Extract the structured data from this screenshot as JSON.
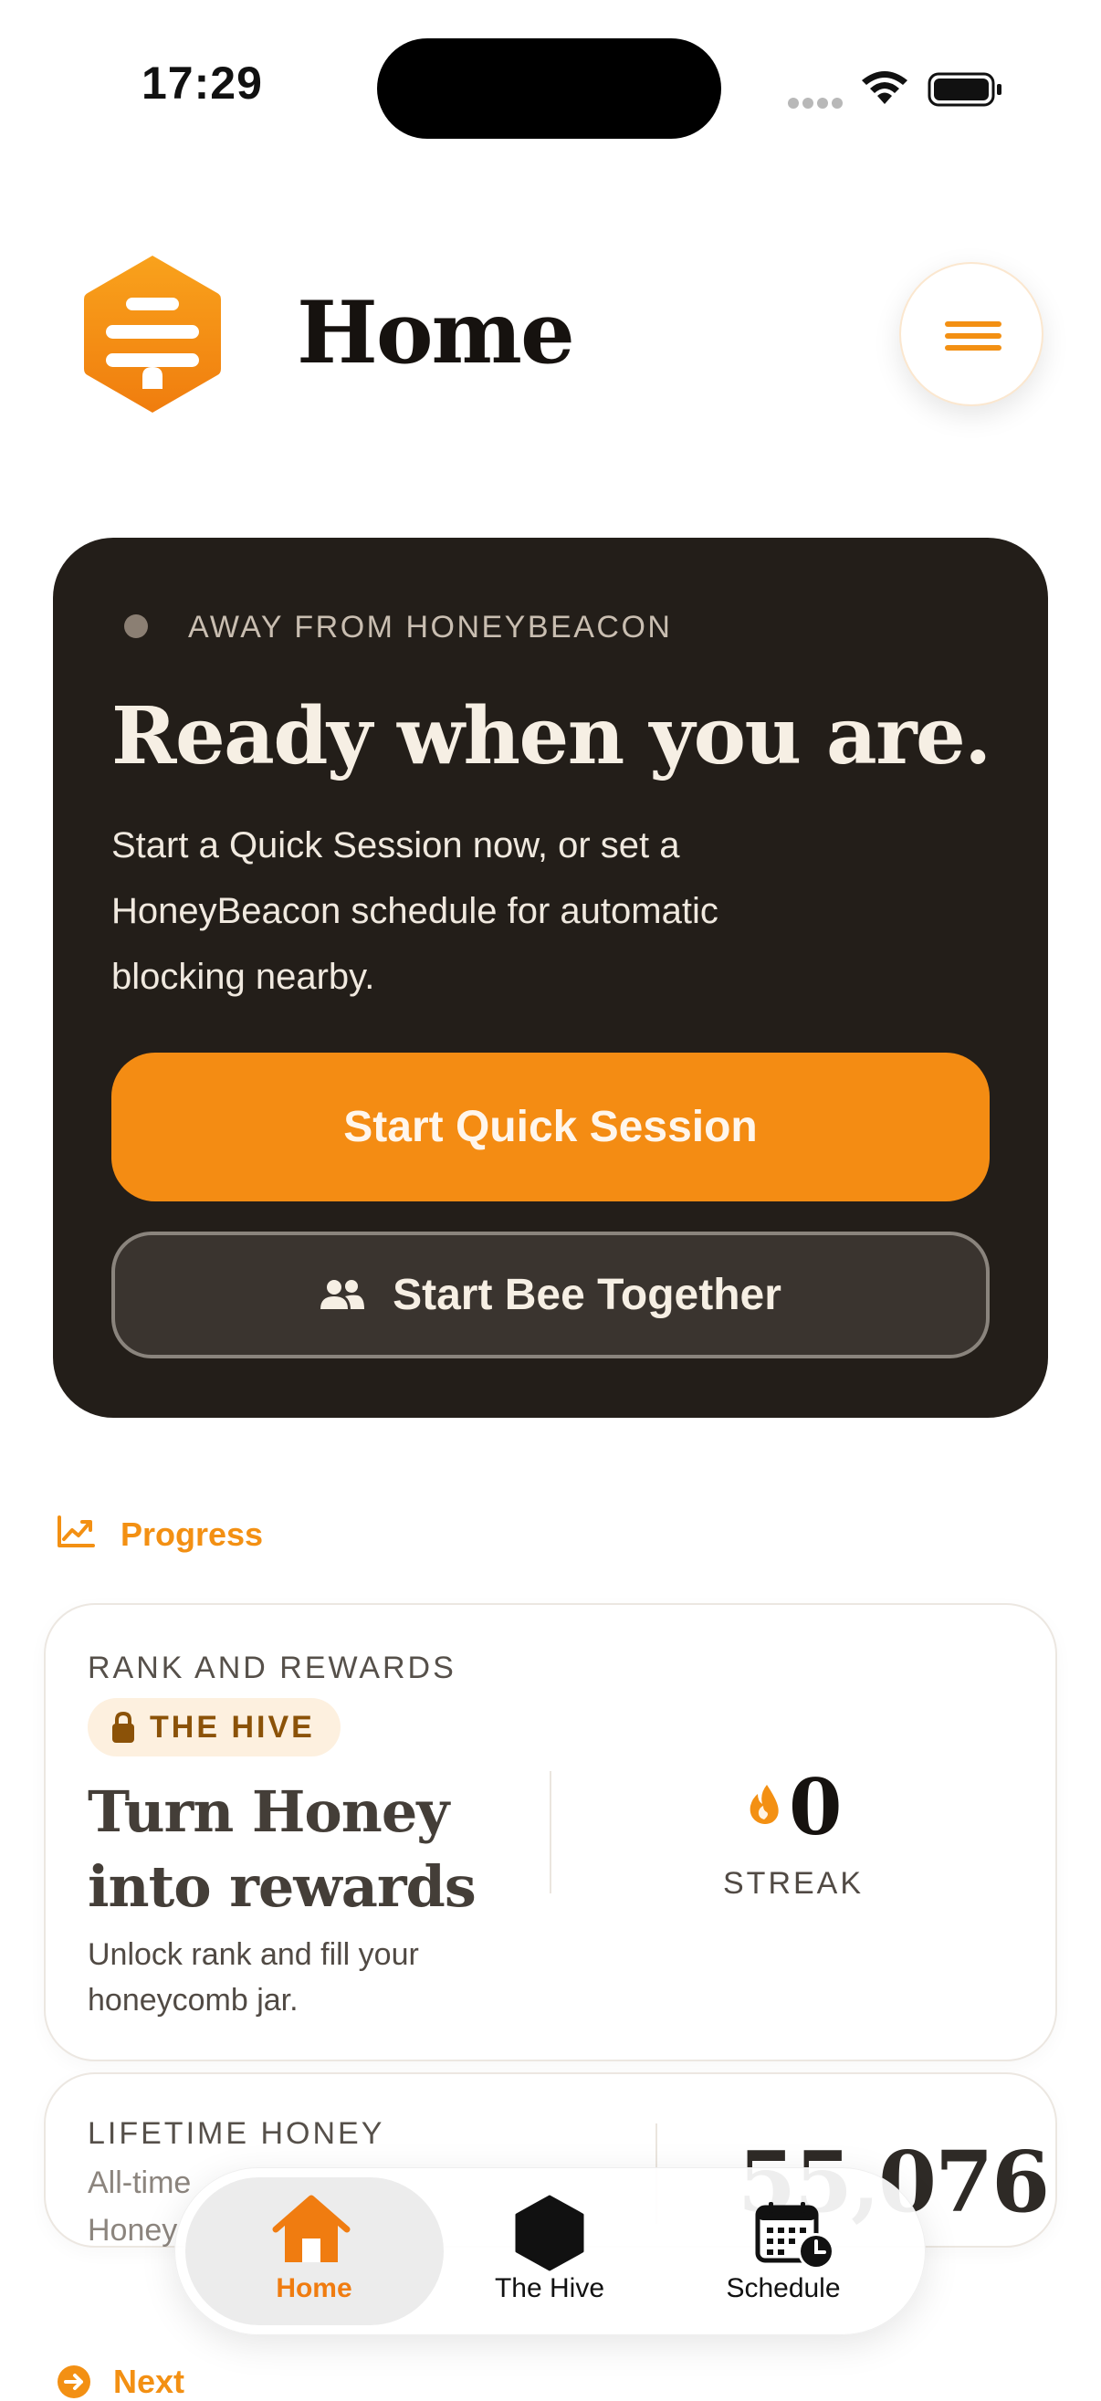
{
  "status_bar": {
    "time": "17:29",
    "icons": [
      "cellular-dots-icon",
      "wifi-icon",
      "battery-icon"
    ]
  },
  "header": {
    "title": "Home",
    "logo_icon": "beehive-logo-icon",
    "menu_icon": "hamburger-menu-icon"
  },
  "hero": {
    "status_text": "AWAY FROM HONEYBEACON",
    "title": "Ready when you are.",
    "body": "Start a Quick Session now, or set a HoneyBeacon schedule for automatic blocking nearby.",
    "primary_button": "Start Quick Session",
    "secondary_button": "Start Bee Together",
    "secondary_icon": "people-icon"
  },
  "progress": {
    "section_label": "Progress",
    "section_icon": "trend-chart-icon",
    "rank_card": {
      "label": "RANK AND REWARDS",
      "badge": "THE HIVE",
      "badge_icon": "lock-icon",
      "title": "Turn Honey into rewards",
      "description": "Unlock rank and fill your honeycomb jar.",
      "streak_value": "0",
      "streak_label": "STREAK",
      "streak_icon": "flame-icon"
    },
    "lifetime_card": {
      "label": "LIFETIME HONEY",
      "desc_line1": "All-time",
      "desc_line2": "Honey",
      "value": "55,076"
    }
  },
  "next_section": {
    "label": "Next",
    "icon": "arrow-circle-icon"
  },
  "tabbar": {
    "tabs": [
      {
        "label": "Home",
        "icon": "house-icon",
        "active": true
      },
      {
        "label": "The Hive",
        "icon": "hexagon-icon",
        "active": false
      },
      {
        "label": "Schedule",
        "icon": "calendar-clock-icon",
        "active": false
      }
    ]
  },
  "colors": {
    "accent": "#f48c13",
    "hero_background": "#231e19",
    "badge_background": "#fdf0df"
  }
}
